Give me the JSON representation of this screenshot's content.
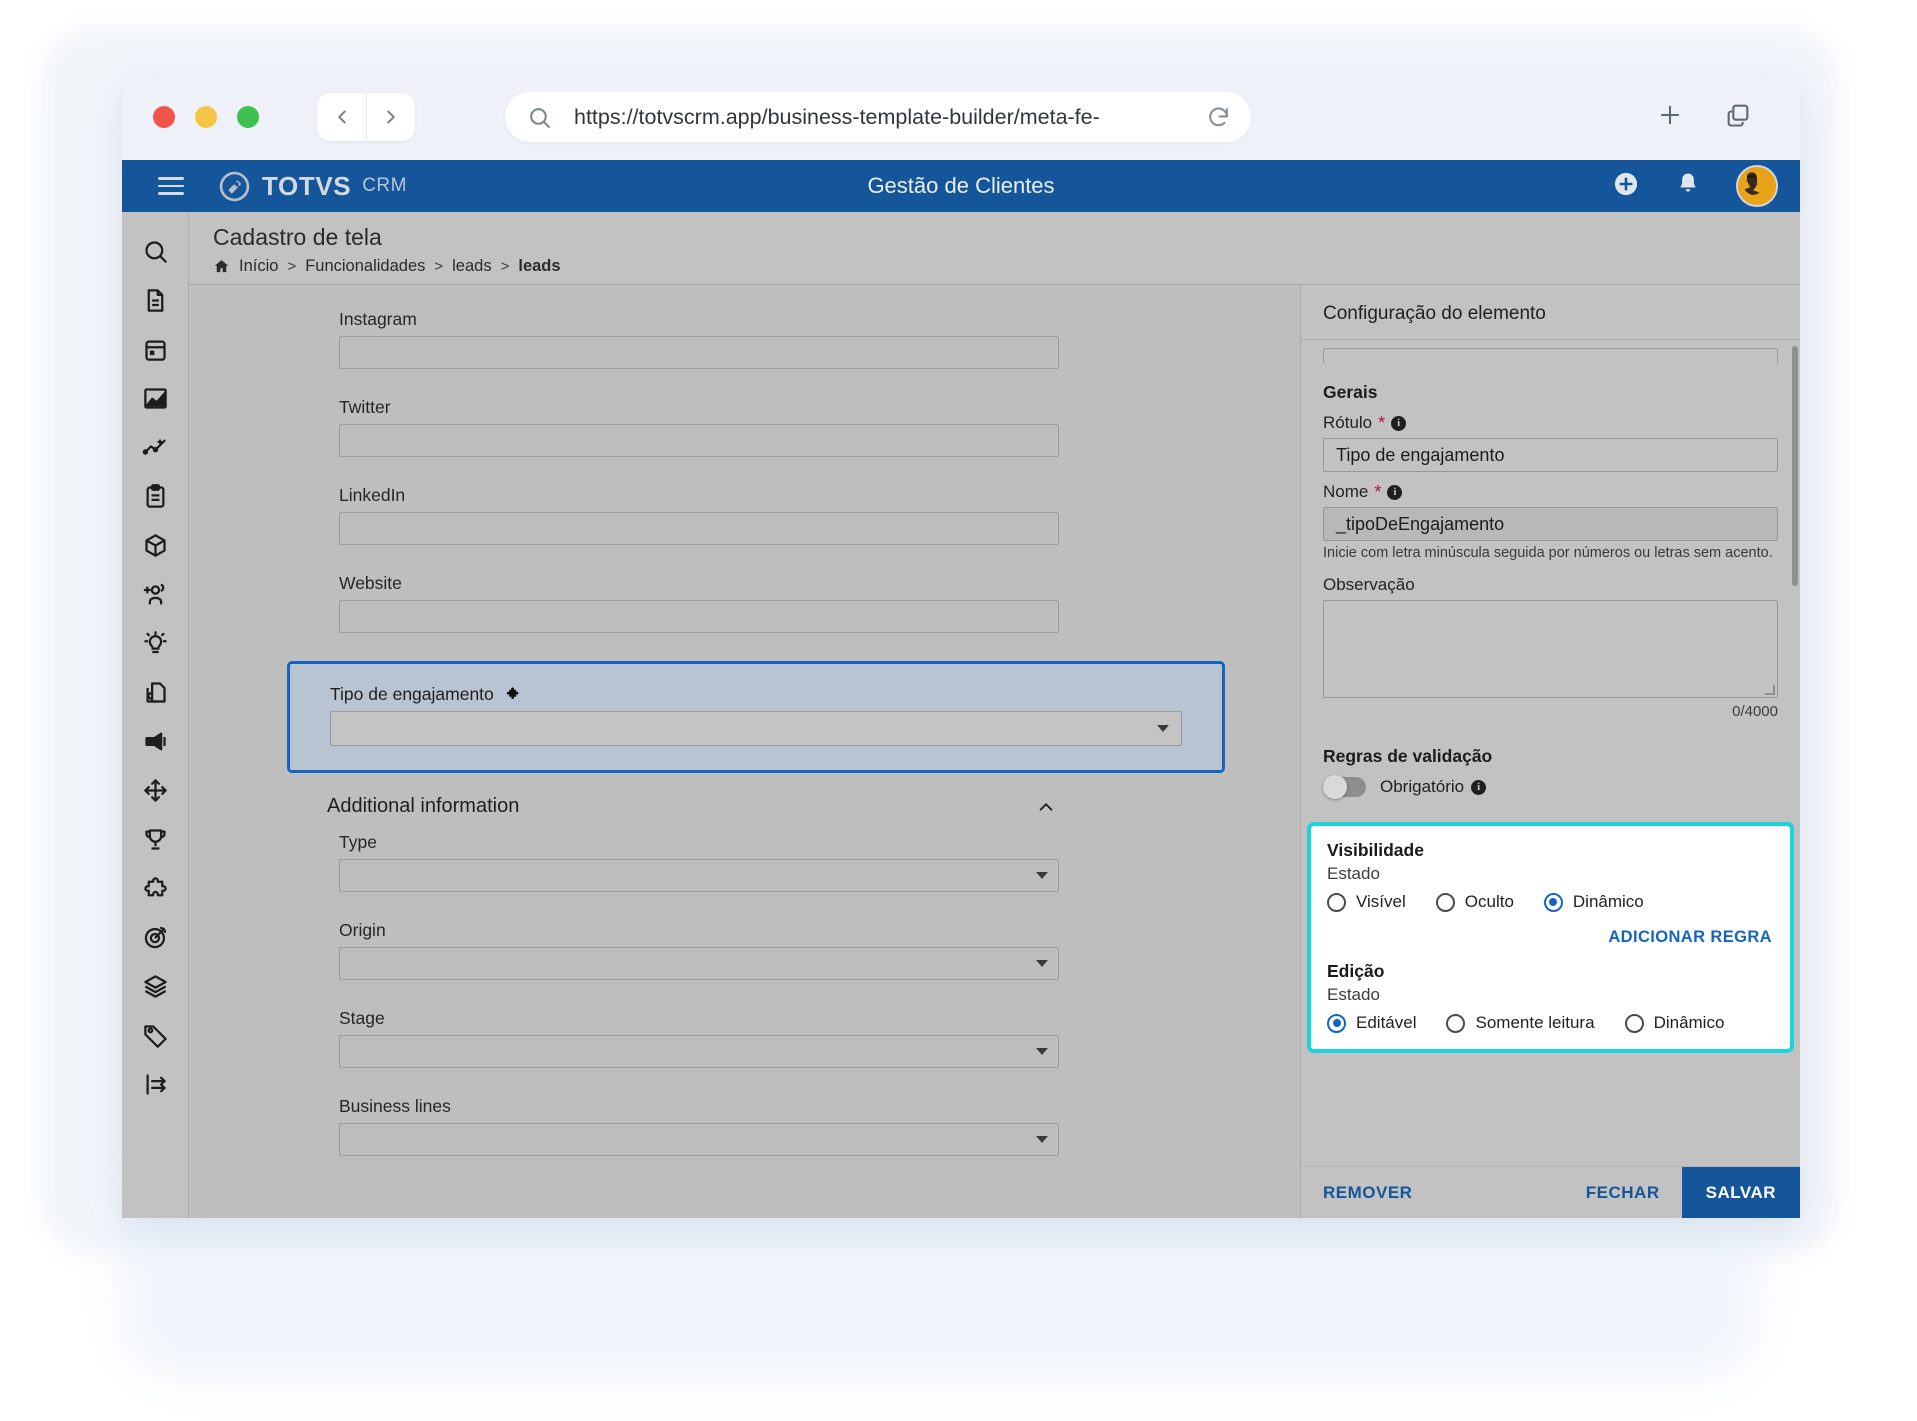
{
  "browser": {
    "url": "https://totvscrm.app/business-template-builder/meta-fe-",
    "icons": {
      "back": "chevron-left-icon",
      "forward": "chevron-right-icon",
      "search": "search-icon",
      "reload": "reload-icon",
      "new_tab": "plus-icon",
      "tabs": "copy-tabs-icon"
    }
  },
  "app_header": {
    "brand": "TOTVS",
    "brand_sub": "CRM",
    "title": "Gestão de Clientes",
    "menu_icon": "hamburger-icon",
    "add_icon": "plus-circle-icon",
    "bell_icon": "bell-icon",
    "avatar": "user-avatar"
  },
  "sidebar": {
    "icons": [
      "search-icon",
      "document-icon",
      "calendar-icon",
      "chart-area-icon",
      "trend-line-icon",
      "clipboard-icon",
      "box-icon",
      "add-user-icon",
      "lightbulb-icon",
      "copy-document-icon",
      "megaphone-icon",
      "move-icon",
      "trophy-icon",
      "puzzle-icon",
      "target-icon",
      "layers-icon",
      "tag-icon",
      "filter-icon"
    ]
  },
  "page": {
    "title": "Cadastro de tela",
    "breadcrumb": [
      {
        "label": "Início",
        "icon": "home-icon"
      },
      {
        "label": "Funcionalidades"
      },
      {
        "label": "leads"
      },
      {
        "label": "leads"
      }
    ],
    "separator": ">"
  },
  "form": {
    "fields": [
      {
        "label": "Instagram",
        "type": "text",
        "value": ""
      },
      {
        "label": "Twitter",
        "type": "text",
        "value": ""
      },
      {
        "label": "LinkedIn",
        "type": "text",
        "value": ""
      },
      {
        "label": "Website",
        "type": "text",
        "value": ""
      }
    ],
    "highlighted_field": {
      "label": "Tipo de engajamento",
      "icon": "puzzle-icon",
      "type": "select",
      "value": ""
    },
    "section": {
      "title": "Additional information",
      "collapse_icon": "chevron-up-icon",
      "fields": [
        {
          "label": "Type",
          "type": "select",
          "value": ""
        },
        {
          "label": "Origin",
          "type": "select",
          "value": ""
        },
        {
          "label": "Stage",
          "type": "select",
          "value": ""
        },
        {
          "label": "Business lines",
          "type": "select",
          "value": ""
        }
      ]
    }
  },
  "config_panel": {
    "title": "Configuração do elemento",
    "gerais": {
      "heading": "Gerais",
      "rotulo_label": "Rótulo",
      "rotulo_value": "Tipo de engajamento",
      "nome_label": "Nome",
      "nome_value": "_tipoDeEngajamento",
      "nome_hint": "Inicie com letra minúscula seguida por números ou letras sem acento.",
      "observacao_label": "Observação",
      "observacao_value": "",
      "observacao_counter": "0/4000",
      "required_mark": "*",
      "info_icon": "info-icon"
    },
    "validacao": {
      "heading": "Regras de validação",
      "obrigatorio_label": "Obrigatório",
      "obrigatorio_on": false,
      "info_icon": "info-icon"
    },
    "visibilidade": {
      "heading": "Visibilidade",
      "estado_label": "Estado",
      "options": [
        {
          "label": "Visível",
          "selected": false
        },
        {
          "label": "Oculto",
          "selected": false
        },
        {
          "label": "Dinâmico",
          "selected": true
        }
      ],
      "add_rule_label": "ADICIONAR REGRA"
    },
    "edicao": {
      "heading": "Edição",
      "estado_label": "Estado",
      "options": [
        {
          "label": "Editável",
          "selected": true
        },
        {
          "label": "Somente leitura",
          "selected": false
        },
        {
          "label": "Dinâmico",
          "selected": false
        }
      ]
    },
    "actions": {
      "remover": "REMOVER",
      "fechar": "FECHAR",
      "salvar": "SALVAR"
    }
  },
  "colors": {
    "brand_blue": "#15559a",
    "highlight_blue": "#1565c0",
    "highlight_cyan": "#1ad3db",
    "required_red": "#b3143a",
    "app_gray": "#c2c2c2"
  }
}
